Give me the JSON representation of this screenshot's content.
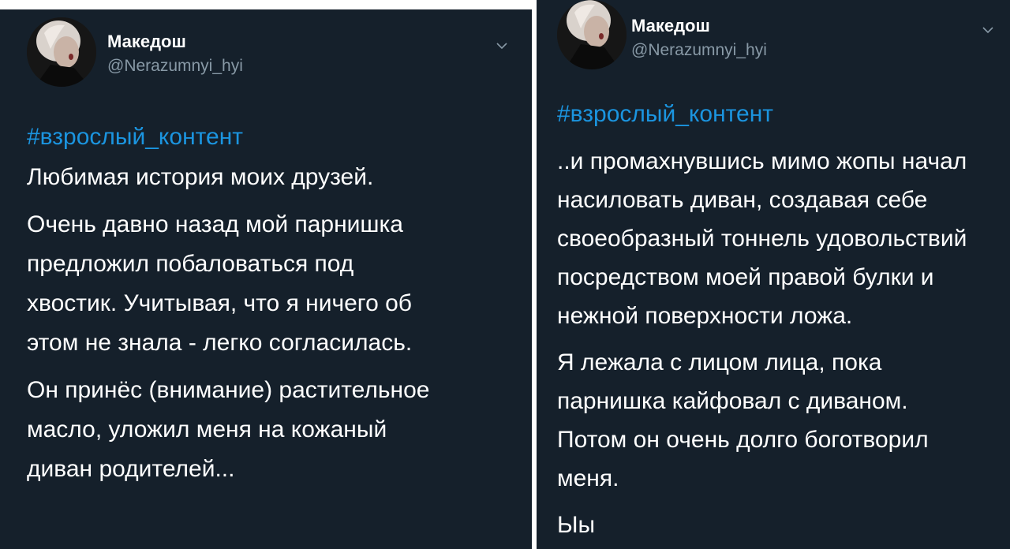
{
  "tweets": [
    {
      "display_name": "Македош",
      "handle": "@Nerazumnyi_hyi",
      "hashtag": "#взрослый_контент",
      "paragraphs": [
        [
          "Любимая история моих друзей."
        ],
        [
          "Очень давно назад мой парнишка",
          "предложил побаловаться под",
          "хвостик. Учитывая, что я ничего об",
          "этом не знала - легко согласилась."
        ],
        [
          "Он принёс (внимание) растительное",
          "масло, уложил меня на кожаный",
          "диван родителей..."
        ]
      ]
    },
    {
      "display_name": "Македош",
      "handle": "@Nerazumnyi_hyi",
      "hashtag": "#взрослый_контент",
      "paragraphs": [
        [
          "..и промахнувшись мимо жопы начал",
          "насиловать диван, создавая себе",
          "своеобразный тоннель удовольствий",
          "посредством моей правой булки и",
          "нежной поверхности ложа."
        ],
        [
          "Я лежала с лицом лица, пока",
          "парнишка кайфовал с диваном.",
          "Потом он очень долго боготворил",
          "меня."
        ],
        [
          "Ыы"
        ]
      ]
    }
  ],
  "theme": {
    "background": "#15202b",
    "text": "#ffffff",
    "secondary_text": "#8899a6",
    "link": "#1b95e0"
  },
  "icons": {
    "more": "chevron-down-icon",
    "avatar": "profile-photo"
  }
}
